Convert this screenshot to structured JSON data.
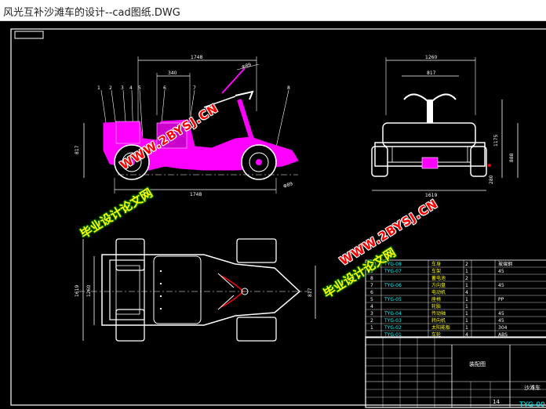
{
  "window": {
    "title": "风光互补沙滩车的设计--cad图纸.DWG"
  },
  "dims": {
    "side_top_width": "1748",
    "side_top_inner": "340",
    "side_bottom_width": "1748",
    "side_height": "817",
    "front_top_width": "1260",
    "front_inner_width": "817",
    "front_bottom_width": "1619",
    "front_height1": "1175",
    "front_height2": "888",
    "front_small": "280",
    "top_height1": "1619",
    "top_height2": "1260",
    "top_right": "817",
    "angle_top": "Φ89",
    "angle_bottom": "Φ89"
  },
  "part_numbers": [
    "1",
    "2",
    "3",
    "4",
    "5",
    "6",
    "7",
    "8"
  ],
  "bom": [
    {
      "no": "10",
      "code": "TYG-08",
      "name": "车身",
      "qty": "2",
      "mat": "玻璃钢"
    },
    {
      "no": "9",
      "code": "TYG-07",
      "name": "车架",
      "qty": "1",
      "mat": "45"
    },
    {
      "no": "8",
      "code": "",
      "name": "蓄电池",
      "qty": "2",
      "mat": ""
    },
    {
      "no": "7",
      "code": "TYG-06",
      "name": "方向盘",
      "qty": "1",
      "mat": "45"
    },
    {
      "no": "6",
      "code": "",
      "name": "电动机",
      "qty": "4",
      "mat": ""
    },
    {
      "no": "5",
      "code": "TYG-05",
      "name": "座椅",
      "qty": "1",
      "mat": "PP"
    },
    {
      "no": "4",
      "code": "",
      "name": "轮胎",
      "qty": "1",
      "mat": ""
    },
    {
      "no": "3",
      "code": "TYG-04",
      "name": "传动轴",
      "qty": "1",
      "mat": "45"
    },
    {
      "no": "2",
      "code": "TYG-03",
      "name": "转向机",
      "qty": "1",
      "mat": "45"
    },
    {
      "no": "1",
      "code": "TYG-02",
      "name": "太阳能板",
      "qty": "1",
      "mat": "304"
    },
    {
      "no": "",
      "code": "TYG-01",
      "name": "车轮",
      "qty": "4",
      "mat": "ABS"
    }
  ],
  "title_block": {
    "drawing_name": "装配图",
    "project": "沙滩车",
    "sheet": "14",
    "drawing_code": "TYG-00"
  },
  "watermarks": {
    "url": "WWW.2BYSJ.CN",
    "cn": "毕业设计论文网"
  },
  "colors": {
    "bg": "#000000",
    "line": "#ffffff",
    "dim": "#00ffff",
    "body": "#ff00ff",
    "red": "#ff0000",
    "yellow": "#ffff00",
    "green": "#00ff00"
  }
}
